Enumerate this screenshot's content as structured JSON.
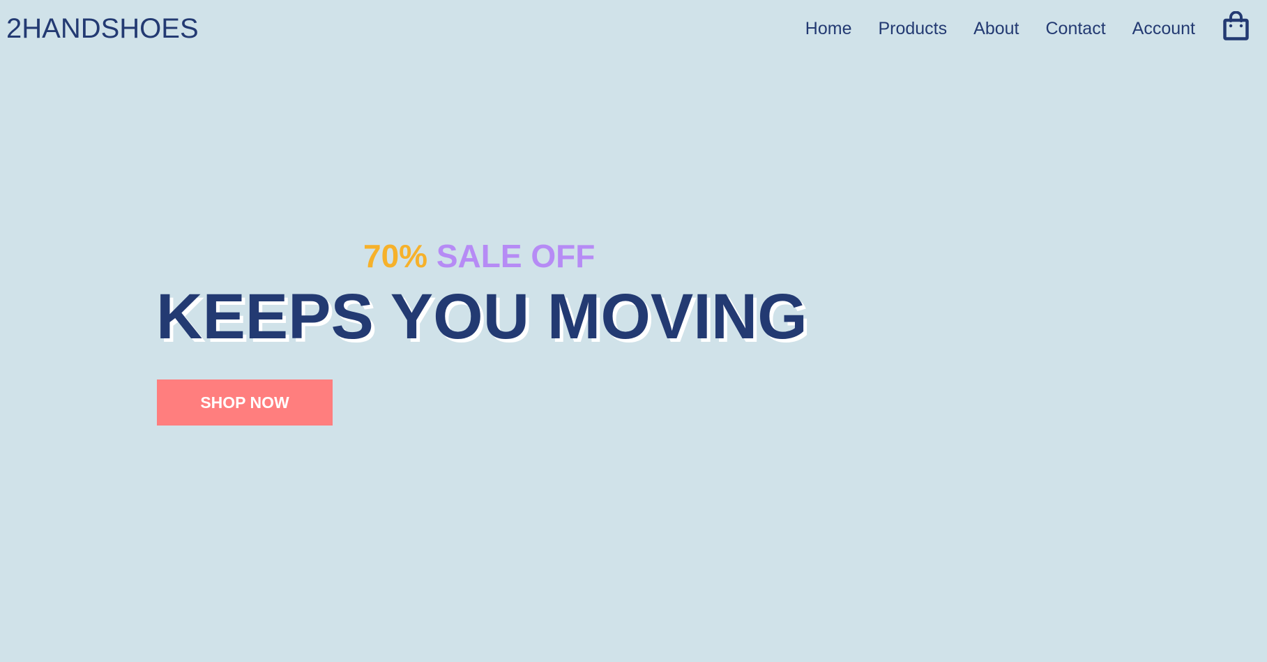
{
  "brand": {
    "name": "2HANDSHOES"
  },
  "nav": {
    "items": [
      {
        "label": "Home"
      },
      {
        "label": "Products"
      },
      {
        "label": "About"
      },
      {
        "label": "Contact"
      },
      {
        "label": "Account"
      }
    ],
    "cart_icon": "shopping-bag-icon"
  },
  "hero": {
    "discount": "70%",
    "sale_text": "SALE OFF",
    "headline": "KEEPS YOU MOVING",
    "cta_label": "SHOP NOW"
  },
  "colors": {
    "background": "#d0e2e9",
    "primary_text": "#233a72",
    "discount_accent": "#f6b12a",
    "sale_accent": "#b68bf5",
    "cta_background": "#ff7e7e",
    "cta_text": "#ffffff"
  }
}
